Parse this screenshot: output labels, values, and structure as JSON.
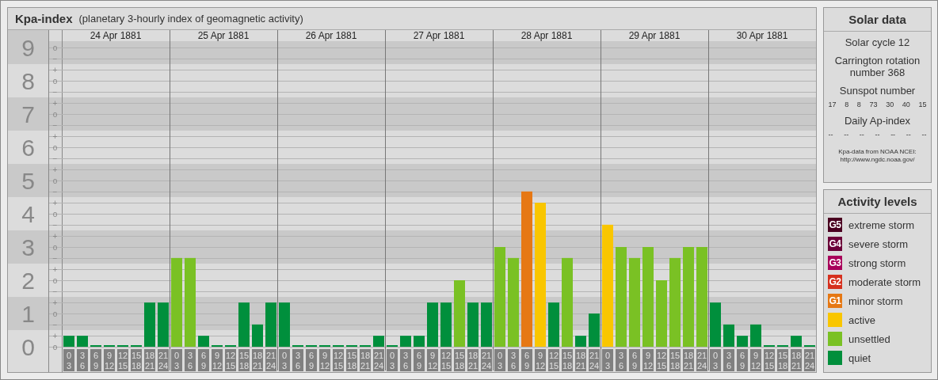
{
  "header": {
    "title": "Kpa-index",
    "subtitle": "(planetary 3-hourly index of geomagnetic activity)"
  },
  "kpa_chart": {
    "days": [
      "24 Apr 1881",
      "25 Apr 1881",
      "26 Apr 1881",
      "27 Apr 1881",
      "28 Apr 1881",
      "29 Apr 1881",
      "30 Apr 1881"
    ],
    "sub_ticks": [
      "o",
      "−",
      "+",
      "o",
      "−",
      "+",
      "o",
      "−",
      "+",
      "o",
      "−",
      "+",
      "o",
      "−",
      "+",
      "o",
      "−",
      "+",
      "o",
      "−",
      "+",
      "o",
      "−",
      "+",
      "o",
      "−",
      "+",
      "o"
    ],
    "chart_data": {
      "type": "bar",
      "ylim": [
        0,
        9
      ],
      "grid": true,
      "yticks": [
        {
          "value": 9,
          "label": "9"
        },
        {
          "value": 8,
          "label": "8"
        },
        {
          "value": 7,
          "label": "7"
        },
        {
          "value": 6,
          "label": "6"
        },
        {
          "value": 5,
          "label": "5"
        },
        {
          "value": 4,
          "label": "4"
        },
        {
          "value": 3,
          "label": "3"
        },
        {
          "value": 2,
          "label": "2"
        },
        {
          "value": 1,
          "label": "1"
        },
        {
          "value": 0,
          "label": "0"
        }
      ],
      "categories": [
        "0 3",
        "3 6",
        "6 9",
        "9 12",
        "12 15",
        "15 18",
        "18 21",
        "21 24",
        "0 3",
        "3 6",
        "6 9",
        "9 12",
        "12 15",
        "15 18",
        "18 21",
        "21 24",
        "0 3",
        "3 6",
        "6 9",
        "9 12",
        "12 15",
        "15 18",
        "18 21",
        "21 24",
        "0 3",
        "3 6",
        "6 9",
        "9 12",
        "12 15",
        "15 18",
        "18 21",
        "21 24",
        "0 3",
        "3 6",
        "6 9",
        "9 12",
        "12 15",
        "15 18",
        "18 21",
        "21 24",
        "0 3",
        "3 6",
        "6 9",
        "9 12",
        "12 15",
        "15 18",
        "18 21",
        "21 24",
        "0 3",
        "3 6",
        "6 9",
        "9 12",
        "12 15",
        "15 18",
        "18 21",
        "21 24"
      ],
      "series": [
        {
          "color": "#008f3c",
          "values": [
            0.33,
            0.33,
            0,
            0,
            0,
            0,
            1.33,
            1.33,
            null,
            null,
            0.33,
            0,
            0,
            1.33,
            0.67,
            1.33,
            1.33,
            0,
            0,
            0,
            0,
            0,
            0,
            0.33,
            0,
            0.33,
            0.33,
            1.33,
            1.33,
            null,
            1.33,
            1.33,
            null,
            null,
            null,
            null,
            1.33,
            null,
            0.33,
            1,
            null,
            null,
            null,
            null,
            null,
            null,
            null,
            null,
            1.33,
            0.67,
            0.33,
            0.67,
            0,
            0,
            0.33,
            0
          ]
        },
        {
          "color": "#7ac124",
          "values": [
            null,
            null,
            null,
            null,
            null,
            null,
            null,
            null,
            2.67,
            2.67,
            null,
            null,
            null,
            null,
            null,
            null,
            null,
            null,
            null,
            null,
            null,
            null,
            null,
            null,
            null,
            null,
            null,
            null,
            null,
            2,
            null,
            null,
            3,
            2.67,
            null,
            null,
            null,
            2.67,
            null,
            null,
            null,
            3,
            2.67,
            3,
            2,
            2.67,
            3,
            3,
            null,
            null,
            null,
            null,
            null,
            null,
            null,
            null
          ]
        },
        {
          "color": "#f9c600",
          "values": [
            null,
            null,
            null,
            null,
            null,
            null,
            null,
            null,
            null,
            null,
            null,
            null,
            null,
            null,
            null,
            null,
            null,
            null,
            null,
            null,
            null,
            null,
            null,
            null,
            null,
            null,
            null,
            null,
            null,
            null,
            null,
            null,
            null,
            null,
            null,
            4.33,
            null,
            null,
            null,
            null,
            3.67,
            null,
            null,
            null,
            null,
            null,
            null,
            null,
            null,
            null,
            null,
            null,
            null,
            null,
            null,
            null
          ]
        },
        {
          "color": "#e67814",
          "values": [
            null,
            null,
            null,
            null,
            null,
            null,
            null,
            null,
            null,
            null,
            null,
            null,
            null,
            null,
            null,
            null,
            null,
            null,
            null,
            null,
            null,
            null,
            null,
            null,
            null,
            null,
            null,
            null,
            null,
            null,
            null,
            null,
            null,
            null,
            4.67,
            null,
            null,
            null,
            null,
            null,
            null,
            null,
            null,
            null,
            null,
            null,
            null,
            null,
            null,
            null,
            null,
            null,
            null,
            null,
            null,
            null
          ]
        }
      ]
    }
  },
  "solar_data": {
    "title": "Solar data",
    "solar_cycle": "Solar cycle 12",
    "carrington": "Carrington rotation number 368",
    "sunspot_label": "Sunspot number",
    "sunspot_values": [
      "17",
      "8",
      "8",
      "73",
      "30",
      "40",
      "15"
    ],
    "ap_label": "Daily Ap-index",
    "ap_values": [
      "--",
      "--",
      "--",
      "--",
      "--",
      "--",
      "--"
    ],
    "source": "Kpa-data from NOAA NCEI:",
    "source_url": "http://www.ngdc.noaa.gov/"
  },
  "legend": {
    "title": "Activity levels",
    "items": [
      {
        "badge": "G5",
        "label": "extreme storm",
        "color": "#4a0020"
      },
      {
        "badge": "G4",
        "label": "severe storm",
        "color": "#6b0038"
      },
      {
        "badge": "G3",
        "label": "strong storm",
        "color": "#a8005a"
      },
      {
        "badge": "G2",
        "label": "moderate storm",
        "color": "#d6301e"
      },
      {
        "badge": "G1",
        "label": "minor storm",
        "color": "#e67814"
      },
      {
        "label": "active",
        "color": "#f9c600"
      },
      {
        "label": "unsettled",
        "color": "#7ac124"
      },
      {
        "label": "quiet",
        "color": "#008f3c"
      }
    ]
  }
}
